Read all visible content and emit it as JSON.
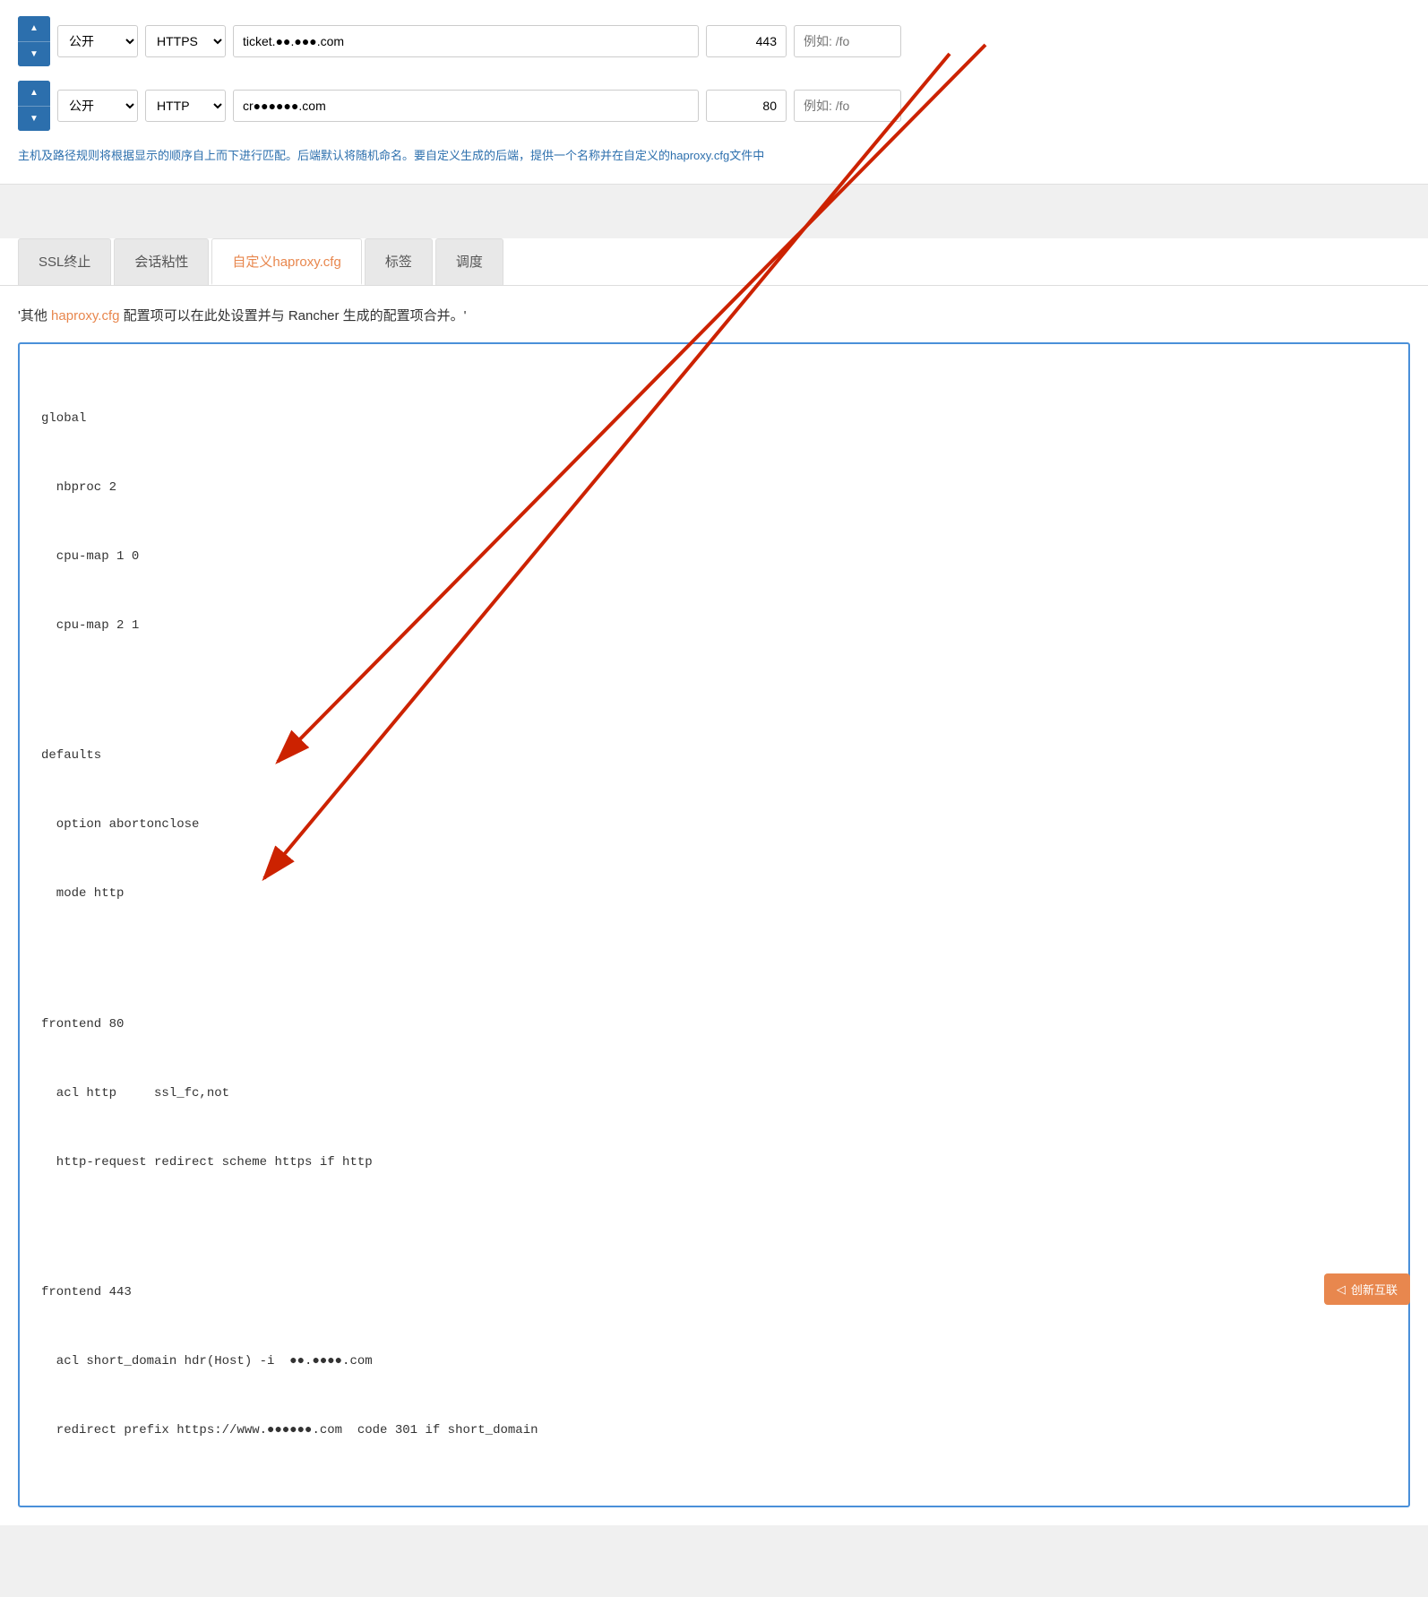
{
  "rows": [
    {
      "access": "公开",
      "protocol": "HTTPS",
      "domain": "ticket.●●.●●●.com",
      "port": "443",
      "placeholder": "例如: /fo"
    },
    {
      "access": "公开",
      "protocol": "HTTP",
      "domain": "cr●●●●●●.com",
      "port": "80",
      "placeholder": "例如: /fo"
    }
  ],
  "info_text": "主机及路径规则将根据显示的顺序自上而下进行匹配。后端默认将随机命名。要自定义生成的后端，提供一个名称并在自定义的haproxy.cfg文件中",
  "tabs": [
    {
      "id": "ssl",
      "label": "SSL终止",
      "active": false
    },
    {
      "id": "sticky",
      "label": "会话粘性",
      "active": false
    },
    {
      "id": "haproxy",
      "label": "自定义haproxy.cfg",
      "active": true
    },
    {
      "id": "tags",
      "label": "标签",
      "active": false
    },
    {
      "id": "schedule",
      "label": "调度",
      "active": false
    }
  ],
  "description": "'其他 haproxy.cfg 配置项可以在此处设置并与 Rancher 生成的配置项合并。'",
  "description_link": "haproxy.cfg",
  "code_lines": [
    "global",
    "  nbproc 2",
    "  cpu-map 1 0",
    "  cpu-map 2 1",
    "",
    "defaults",
    "  option abortonclose",
    "  mode http",
    "",
    "frontend 80",
    "  acl http     ssl_fc,not",
    "  http-request redirect scheme https if http",
    "",
    "frontend 443",
    "  acl short_domain hdr(Host) -i  ●●.●●●●.com",
    "  redirect prefix https://www.●●●●●●.com  code 301 if short_domain"
  ],
  "badge": {
    "icon": "◁",
    "text": "创新互联"
  },
  "colors": {
    "accent_blue": "#2c6fad",
    "accent_orange": "#e8874e",
    "border_blue": "#4a90d9"
  }
}
